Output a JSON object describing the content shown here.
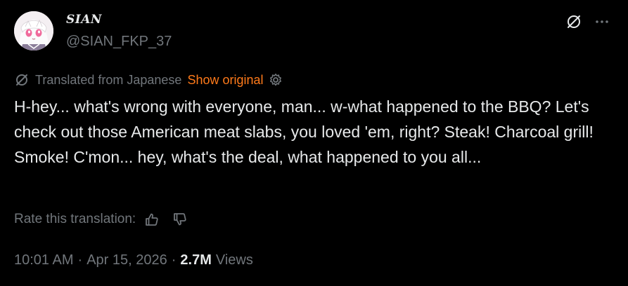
{
  "author": {
    "display_name": "SIAN",
    "handle": "@SIAN_FKP_37",
    "avatar_icon": "anime-avatar"
  },
  "header_icons": [
    "translate-icon",
    "more-icon"
  ],
  "translation": {
    "label": "Translated from Japanese",
    "show_original": "Show original",
    "icon": "translate-icon",
    "settings_icon": "gear-icon"
  },
  "tweet": {
    "text": "H-hey... what's wrong with everyone, man... w-what happened to the BBQ? Let's check out those American meat slabs, you loved 'em, right? Steak! Charcoal grill! Smoke! C'mon... hey, what's the deal, what happened to you all..."
  },
  "rate": {
    "label": "Rate this translation:",
    "icons": [
      "thumbs-up-icon",
      "thumbs-down-icon"
    ]
  },
  "meta": {
    "time": "10:01 AM",
    "sep1": "·",
    "date": "Apr 15, 2026",
    "sep2": "·",
    "views_count": "2.7M",
    "views_label": "Views"
  },
  "colors": {
    "background": "#000000",
    "text": "#e7e9ea",
    "muted": "#71767b",
    "link": "#ff7a1a"
  }
}
